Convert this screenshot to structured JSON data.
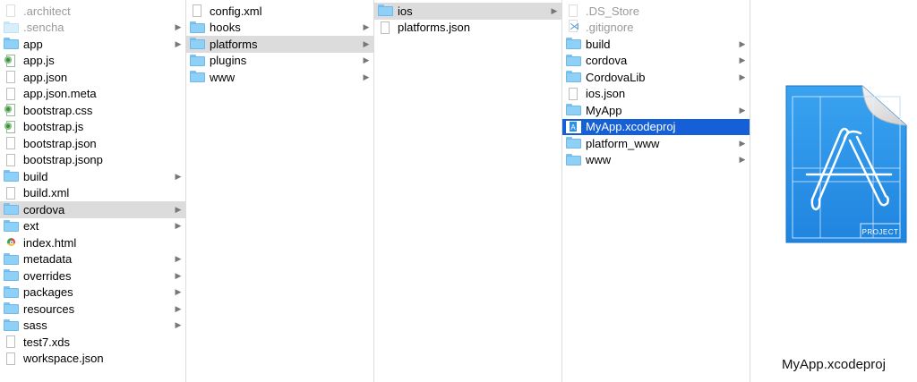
{
  "columns": [
    {
      "items": [
        {
          "label": ".architect",
          "icon": "file-icon",
          "dim": true,
          "arrow": false
        },
        {
          "label": ".sencha",
          "icon": "folder-icon",
          "dim": true,
          "arrow": true
        },
        {
          "label": "app",
          "icon": "folder-icon",
          "arrow": true
        },
        {
          "label": "app.js",
          "icon": "script-file-icon",
          "arrow": false
        },
        {
          "label": "app.json",
          "icon": "file-icon",
          "arrow": false
        },
        {
          "label": "app.json.meta",
          "icon": "file-icon",
          "arrow": false
        },
        {
          "label": "bootstrap.css",
          "icon": "script-file-icon",
          "arrow": false
        },
        {
          "label": "bootstrap.js",
          "icon": "script-file-icon",
          "arrow": false
        },
        {
          "label": "bootstrap.json",
          "icon": "file-icon",
          "arrow": false
        },
        {
          "label": "bootstrap.jsonp",
          "icon": "file-icon",
          "arrow": false
        },
        {
          "label": "build",
          "icon": "folder-icon",
          "arrow": true
        },
        {
          "label": "build.xml",
          "icon": "file-icon",
          "arrow": false
        },
        {
          "label": "cordova",
          "icon": "folder-icon",
          "arrow": true,
          "selected": "gray"
        },
        {
          "label": "ext",
          "icon": "folder-icon",
          "arrow": true
        },
        {
          "label": "index.html",
          "icon": "chrome-icon",
          "arrow": false
        },
        {
          "label": "metadata",
          "icon": "folder-icon",
          "arrow": true
        },
        {
          "label": "overrides",
          "icon": "folder-icon",
          "arrow": true
        },
        {
          "label": "packages",
          "icon": "folder-icon",
          "arrow": true
        },
        {
          "label": "resources",
          "icon": "folder-icon",
          "arrow": true
        },
        {
          "label": "sass",
          "icon": "folder-icon",
          "arrow": true
        },
        {
          "label": "test7.xds",
          "icon": "file-icon",
          "arrow": false
        },
        {
          "label": "workspace.json",
          "icon": "file-icon",
          "arrow": false
        }
      ]
    },
    {
      "items": [
        {
          "label": "config.xml",
          "icon": "file-icon",
          "arrow": false
        },
        {
          "label": "hooks",
          "icon": "folder-icon",
          "arrow": true
        },
        {
          "label": "platforms",
          "icon": "folder-icon",
          "arrow": true,
          "selected": "gray"
        },
        {
          "label": "plugins",
          "icon": "folder-icon",
          "arrow": true
        },
        {
          "label": "www",
          "icon": "folder-icon",
          "arrow": true
        }
      ]
    },
    {
      "items": [
        {
          "label": "ios",
          "icon": "folder-icon",
          "arrow": true,
          "selected": "gray"
        },
        {
          "label": "platforms.json",
          "icon": "file-icon",
          "arrow": false
        }
      ]
    },
    {
      "items": [
        {
          "label": ".DS_Store",
          "icon": "file-icon",
          "dim": true,
          "arrow": false
        },
        {
          "label": ".gitignore",
          "icon": "vscode-file-icon",
          "dim": true,
          "arrow": false
        },
        {
          "label": "build",
          "icon": "folder-icon",
          "arrow": true
        },
        {
          "label": "cordova",
          "icon": "folder-icon",
          "arrow": true
        },
        {
          "label": "CordovaLib",
          "icon": "folder-icon",
          "arrow": true
        },
        {
          "label": "ios.json",
          "icon": "file-icon",
          "arrow": false
        },
        {
          "label": "MyApp",
          "icon": "folder-icon",
          "arrow": true
        },
        {
          "label": "MyApp.xcodeproj",
          "icon": "xcodeproj-icon",
          "arrow": false,
          "selected": "blue"
        },
        {
          "label": "platform_www",
          "icon": "folder-icon",
          "arrow": true
        },
        {
          "label": "www",
          "icon": "folder-icon",
          "arrow": true
        }
      ]
    }
  ],
  "preview": {
    "icon": "xcode-project-icon",
    "badge": "PROJECT",
    "filename": "MyApp.xcodeproj"
  },
  "colors": {
    "selection_blue": "#1560d6",
    "selection_gray": "#dcdcdc",
    "folder": "#8fd0f6",
    "xcode_blue": "#2f8fe0"
  }
}
